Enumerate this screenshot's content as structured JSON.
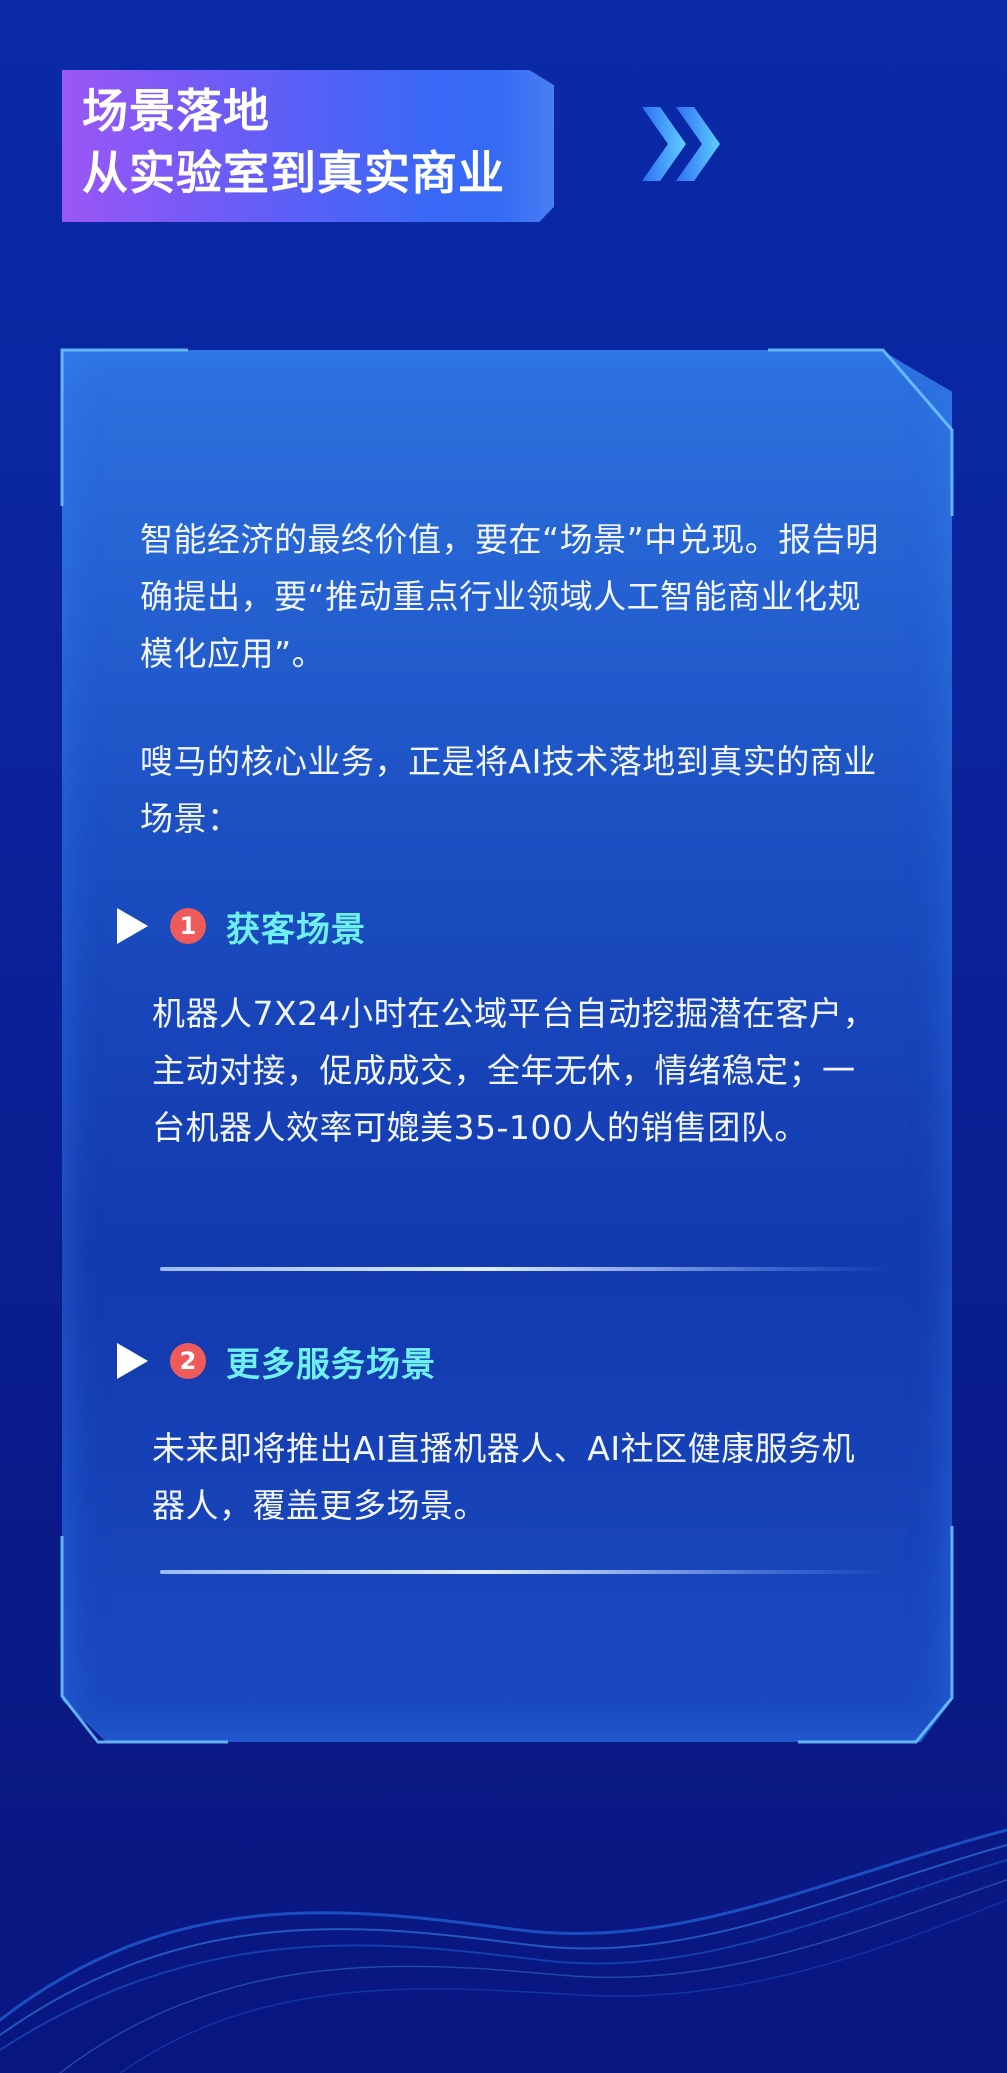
{
  "header": {
    "line1": "场景落地",
    "line2": "从实验室到真实商业"
  },
  "intro": {
    "paragraph1": "智能经济的最终价值，要在“场景”中兑现。报告明确提出，要“推动重点行业领域人工智能商业化规模化应用”。",
    "paragraph2": "嗖马的核心业务，正是将AI技术落地到真实的商业场景："
  },
  "sections": [
    {
      "number": "1",
      "title": "获客场景",
      "description": "机器人7X24小时在公域平台自动挖掘潜在客户，主动对接，促成成交，全年无休，情绪稳定；一台机器人效率可媲美35-100人的销售团队。"
    },
    {
      "number": "2",
      "title": "更多服务场景",
      "description": "未来即将推出AI直播机器人、AI社区健康服务机器人，覆盖更多场景。"
    }
  ],
  "colors": {
    "background": "#0a2aa8",
    "heading_accent": "#6ef0ee",
    "badge": "#ef5b5b",
    "banner_start": "#9b57f5",
    "banner_end": "#2f6cf2"
  },
  "icons": {
    "header_decoration": "double-chevron-right-icon",
    "section_marker": "play-triangle-icon"
  }
}
